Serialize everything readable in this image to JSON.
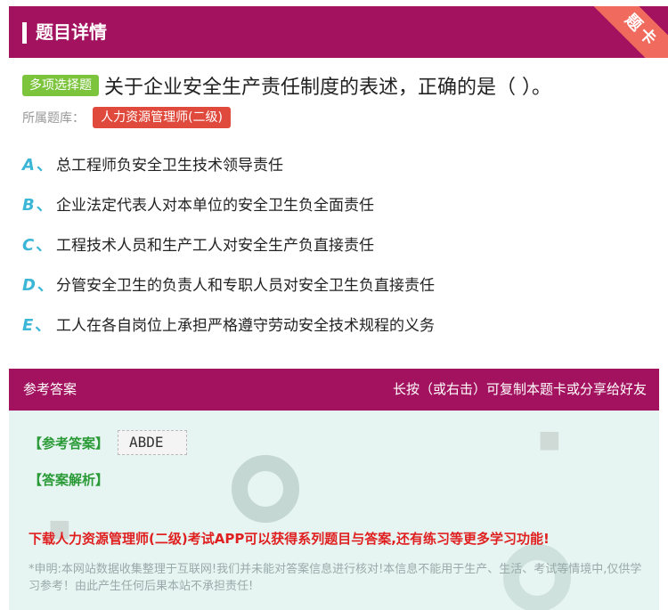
{
  "header": {
    "title": "题目详情",
    "ribbon": "题卡"
  },
  "question": {
    "type_badge": "多项选择题",
    "text": "关于企业安全生产责任制度的表述，正确的是（ ）。",
    "bank_label": "所属题库：",
    "bank_tag": "人力资源管理师(二级)"
  },
  "options": [
    {
      "letter": "A",
      "sep": "、",
      "text": "总工程师负安全卫生技术领导责任"
    },
    {
      "letter": "B",
      "sep": "、",
      "text": "企业法定代表人对本单位的安全卫生负全面责任"
    },
    {
      "letter": "C",
      "sep": "、",
      "text": "工程技术人员和生产工人对安全生产负直接责任"
    },
    {
      "letter": "D",
      "sep": "、",
      "text": "分管安全卫生的负责人和专职人员对安全卫生负直接责任"
    },
    {
      "letter": "E",
      "sep": "、",
      "text": "工人在各自岗位上承担严格遵守劳动安全技术规程的义务"
    }
  ],
  "answer": {
    "section_title": "参考答案",
    "share_hint": "长按（或右击）可复制本题卡或分享给好友",
    "answer_label": "【参考答案】",
    "answer_value": "ABDE",
    "analysis_label": "【答案解析】",
    "promo": "下载人力资源管理师(二级)考试APP可以获得系列题目与答案,还有练习等更多学习功能!",
    "disclaimer": "*申明:本网站数据收集整理于互联网!我们并未能对答案信息进行核对!本信息不能用于生产、生活、考试等情境中,仅供学习参考！由此产生任何后果本站不承担责任!"
  },
  "colors": {
    "header_bg": "#a3125f",
    "type_badge": "#7cc43c",
    "bank_tag": "#e04a3c",
    "option_letter": "#3cb6d6",
    "answer_bg": "#e6f5f2",
    "answer_label": "#2a9a36",
    "promo": "#e02020"
  }
}
